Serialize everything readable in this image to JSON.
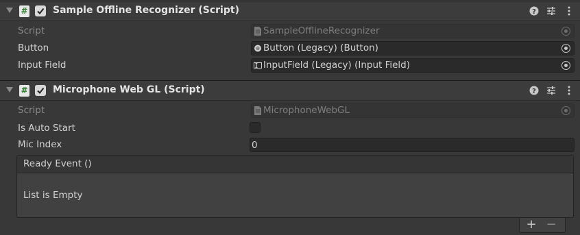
{
  "components": [
    {
      "title": "Sample Offline Recognizer (Script)",
      "fields": {
        "script": {
          "label": "Script",
          "value": "SampleOfflineRecognizer"
        },
        "button": {
          "label": "Button",
          "value": "Button (Legacy) (Button)"
        },
        "input_field": {
          "label": "Input Field",
          "value": "InputField (Legacy) (Input Field)"
        }
      }
    },
    {
      "title": "Microphone Web GL (Script)",
      "fields": {
        "script": {
          "label": "Script",
          "value": "MicrophoneWebGL"
        },
        "is_auto_start": {
          "label": "Is Auto Start",
          "checked": false
        },
        "mic_index": {
          "label": "Mic Index",
          "value": "0"
        }
      },
      "event": {
        "title": "Ready Event ()",
        "empty_text": "List is Empty",
        "add_label": "+",
        "remove_label": "−"
      }
    }
  ],
  "icons": {
    "script": "script-hash-icon",
    "help": "help-icon",
    "presets": "presets-sliders-icon",
    "context_menu": "kebab-menu-icon",
    "object_picker": "object-picker-icon"
  },
  "colors": {
    "background": "#383838",
    "header": "#3c3c3c",
    "field": "#2a2a2a",
    "script_green": "#2f7a30",
    "text": "#d2d2d2",
    "text_dim": "#8a8a8a"
  }
}
